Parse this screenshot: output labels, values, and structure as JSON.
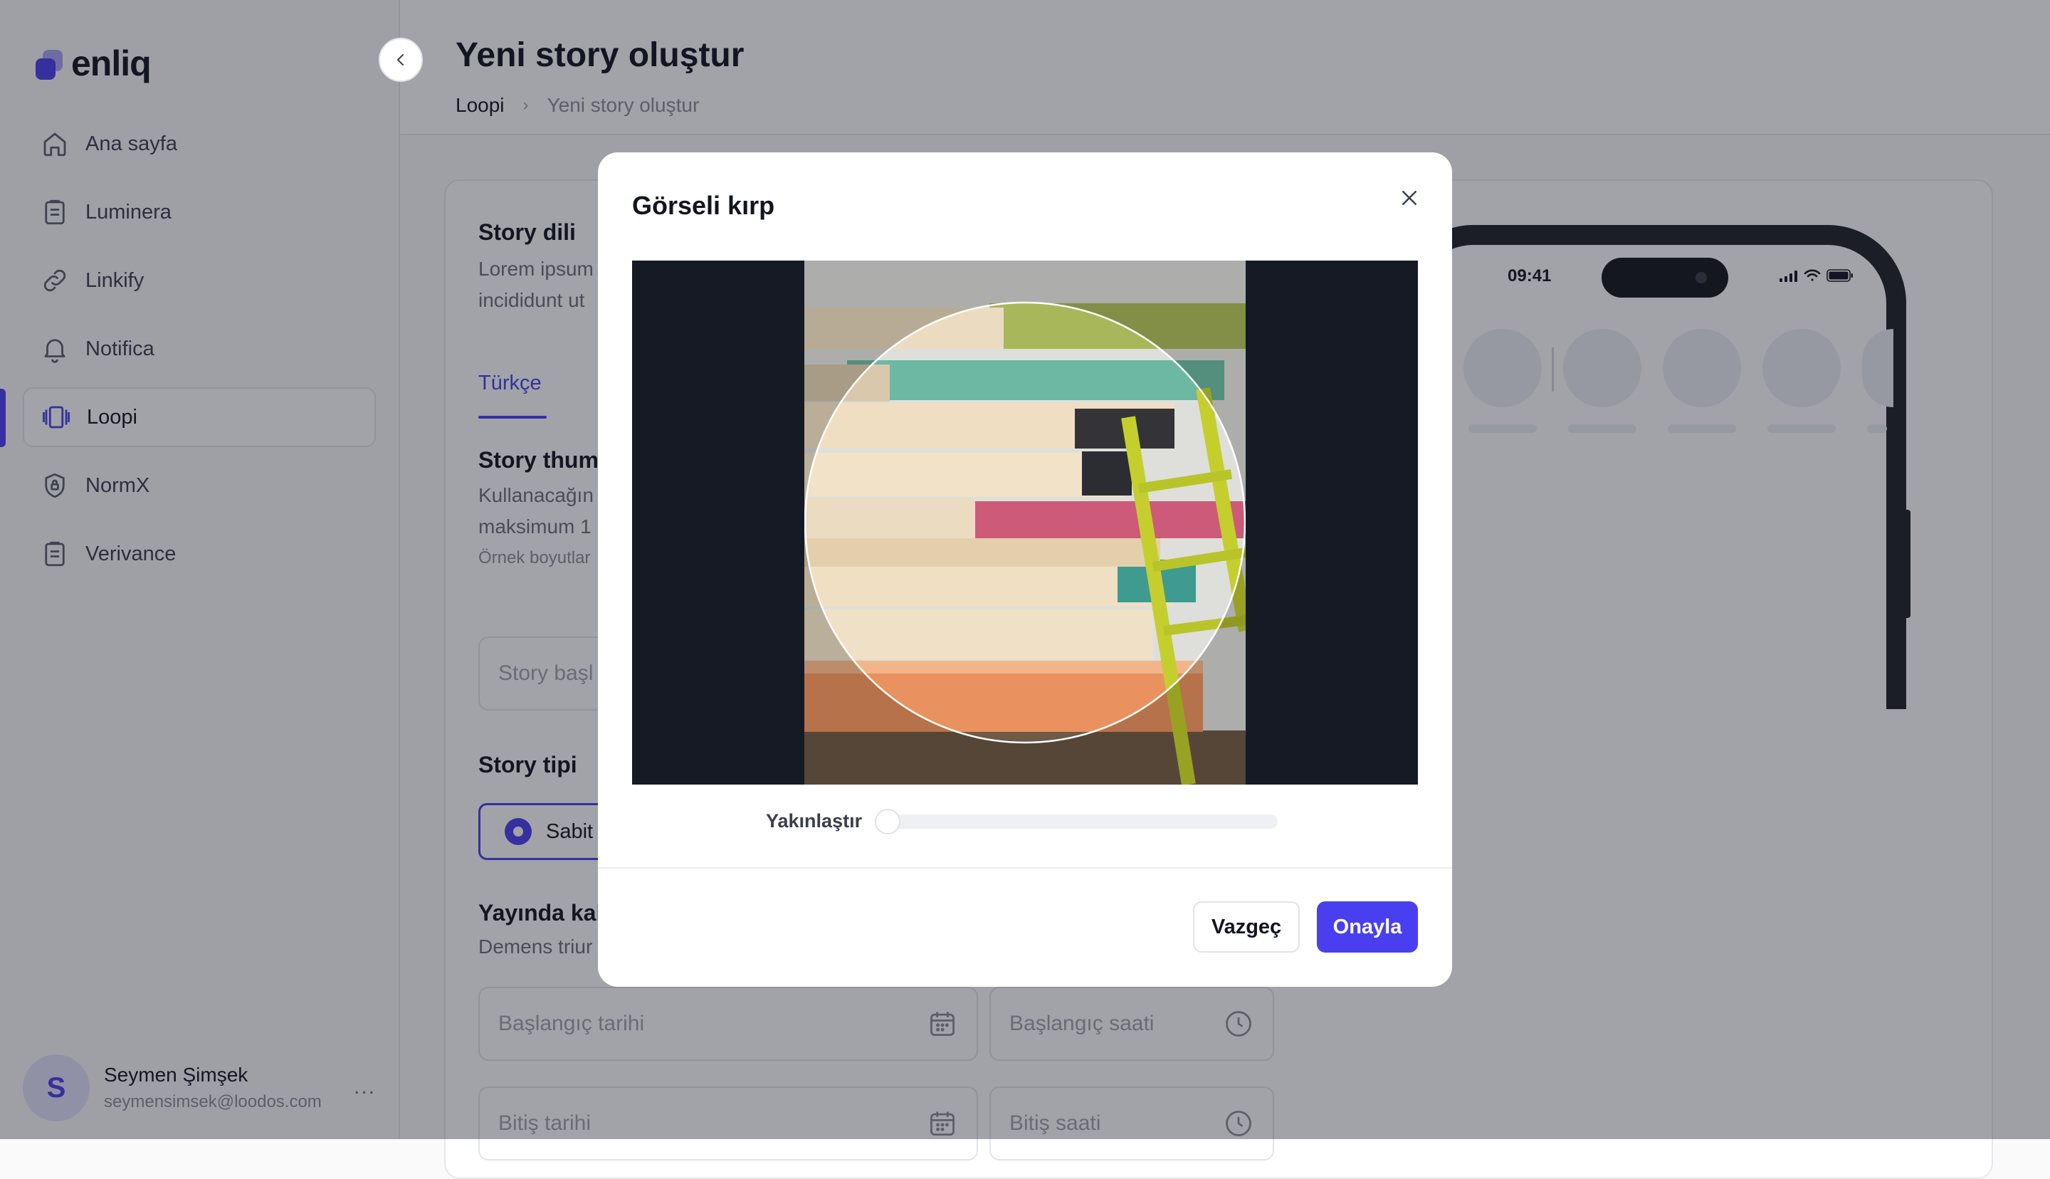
{
  "brand": {
    "name": "enliq",
    "accent": "#4a3ff0"
  },
  "sidebar": {
    "items": [
      {
        "label": "Ana sayfa",
        "icon": "home-icon"
      },
      {
        "label": "Luminera",
        "icon": "clipboard-icon"
      },
      {
        "label": "Linkify",
        "icon": "link-icon"
      },
      {
        "label": "Notifica",
        "icon": "bell-icon"
      },
      {
        "label": "Loopi",
        "icon": "stories-icon",
        "active": true
      },
      {
        "label": "NormX",
        "icon": "shield-icon"
      },
      {
        "label": "Verivance",
        "icon": "clipboard-icon"
      }
    ],
    "user": {
      "initial": "S",
      "name": "Seymen Şimşek",
      "email": "seymensimsek@loodos.com",
      "more": "..."
    }
  },
  "header": {
    "title": "Yeni story oluştur",
    "breadcrumb": {
      "root": "Loopi",
      "separator": "›",
      "current": "Yeni story oluştur"
    }
  },
  "form": {
    "language_title": "Story dili",
    "language_desc_1": "Lorem ipsum",
    "language_desc_2": "incididunt ut",
    "tab_turkish": "Türkçe",
    "thumbnail_title": "Story thum",
    "thumbnail_desc_1": "Kullanacağın",
    "thumbnail_desc_2": "maksimum 1",
    "thumbnail_example": "Örnek boyutlar",
    "story_title_placeholder": "Story başl",
    "type_title": "Story tipi",
    "type_option_static": "Sabit",
    "live_title": "Yayında kal",
    "live_desc": "Demens triur",
    "start_date_placeholder": "Başlangıç tarihi",
    "start_time_placeholder": "Başlangıç saati",
    "end_date_placeholder": "Bitiş tarihi",
    "end_time_placeholder": "Bitiş saati"
  },
  "preview": {
    "time": "09:41"
  },
  "modal": {
    "title": "Görseli kırp",
    "zoom_label": "Yakınlaştır",
    "zoom_level": 0,
    "cancel_label": "Vazgeç",
    "confirm_label": "Onayla"
  }
}
